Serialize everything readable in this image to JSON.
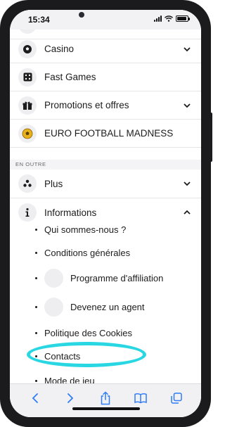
{
  "status": {
    "time": "15:34"
  },
  "menu": {
    "items": [
      {
        "label": "Casino",
        "icon": "soccer-ball-icon",
        "expandable": true,
        "expanded": false
      },
      {
        "label": "Fast Games",
        "icon": "dice-icon",
        "expandable": false
      },
      {
        "label": "Promotions et offres",
        "icon": "gift-icon",
        "expandable": true,
        "expanded": false
      },
      {
        "label": "EURO FOOTBALL MADNESS",
        "icon": "gold-ball-icon",
        "expandable": false
      },
      {
        "label": "Plus",
        "icon": "dots-icon",
        "expandable": true,
        "expanded": false
      },
      {
        "label": "Informations",
        "icon": "info-icon",
        "expandable": true,
        "expanded": true
      }
    ],
    "section_label": "EN OUTRE",
    "info_subitems": [
      "Qui sommes-nous ?",
      "Conditions générales",
      "Programme d'affiliation",
      "Devenez un agent",
      "Politique des Cookies",
      "Contacts",
      "Mode de jeu"
    ]
  },
  "toolbar": {
    "buttons": [
      "back-icon",
      "forward-icon",
      "share-icon",
      "bookmarks-icon",
      "tabs-icon"
    ]
  },
  "colors": {
    "highlight": "#29d7e3",
    "toolbar_icon": "#2f7cf6",
    "ball_gold": "#e9b21a"
  }
}
